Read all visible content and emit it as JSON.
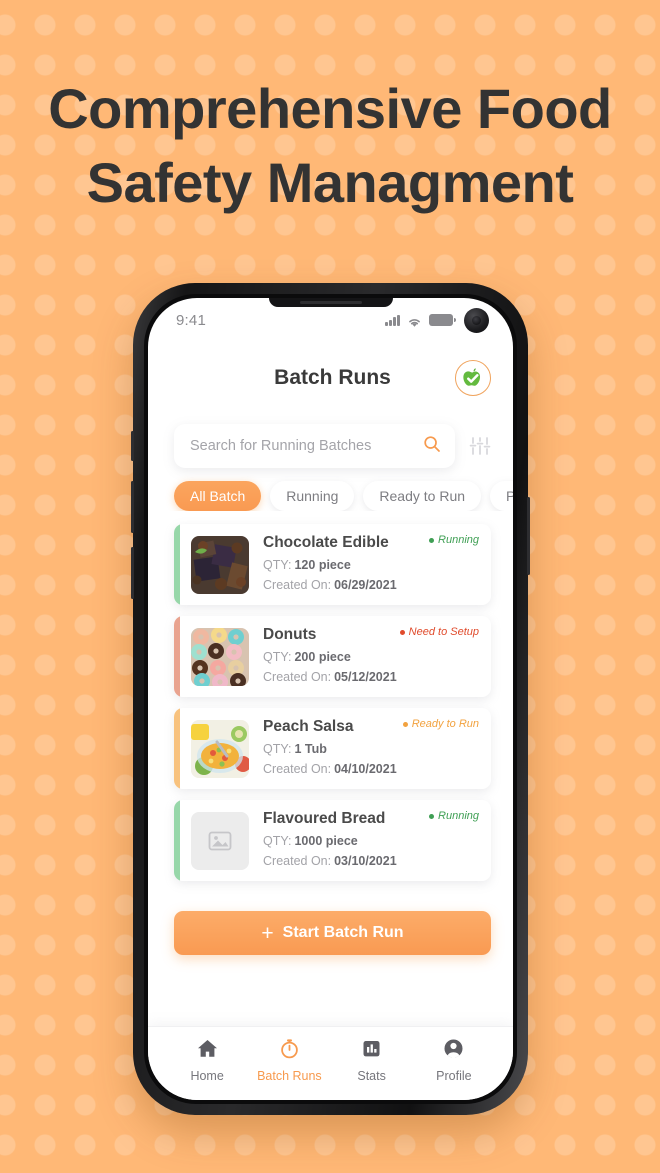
{
  "page": {
    "headline_line1": "Comprehensive Food",
    "headline_line2": "Safety Managment",
    "background_color": "#FFB876",
    "accent_color": "#F79A4E"
  },
  "status_bar": {
    "time": "9:41",
    "signal_icon": "cellular-signal-icon",
    "wifi_icon": "wifi-icon",
    "battery_icon": "battery-icon",
    "camera_icon": "front-camera-icon"
  },
  "app_header": {
    "title": "Batch Runs",
    "brand_badge_icon": "green-apple-check-badge-icon"
  },
  "search": {
    "placeholder": "Search for Running Batches",
    "value": "",
    "search_icon": "search-icon",
    "filter_icon": "filter-sliders-icon"
  },
  "chips": [
    {
      "label": "All Batch",
      "active": true
    },
    {
      "label": "Running",
      "active": false
    },
    {
      "label": "Ready to Run",
      "active": false
    },
    {
      "label": "Paused",
      "active": false
    }
  ],
  "batches": [
    {
      "title": "Chocolate Edible",
      "qty_label": "QTY:",
      "qty_value": "120 piece",
      "created_label": "Created On:",
      "created_value": "06/29/2021",
      "status": "Running",
      "status_color": "#3F9F54",
      "accent_color": "#97D7A9",
      "thumb": "chocolate-photo"
    },
    {
      "title": "Donuts",
      "qty_label": "QTY:",
      "qty_value": "200 piece",
      "created_label": "Created On:",
      "created_value": "05/12/2021",
      "status": "Need to Setup",
      "status_color": "#E04B2C",
      "accent_color": "#E9A38F",
      "thumb": "donuts-photo"
    },
    {
      "title": "Peach Salsa",
      "qty_label": "QTY:",
      "qty_value": "1 Tub",
      "created_label": "Created On:",
      "created_value": "04/10/2021",
      "status": "Ready to Run",
      "status_color": "#F2A23F",
      "accent_color": "#F8C27E",
      "thumb": "peach-salsa-photo"
    },
    {
      "title": "Flavoured Bread",
      "qty_label": "QTY:",
      "qty_value": "1000 piece",
      "created_label": "Created On:",
      "created_value": "03/10/2021",
      "status": "Running",
      "status_color": "#3F9F54",
      "accent_color": "#97D7A9",
      "thumb": "image-placeholder-icon"
    }
  ],
  "cta": {
    "plus": "+",
    "label": "Start Batch Run"
  },
  "tabbar": [
    {
      "label": "Home",
      "icon": "home-icon",
      "active": false
    },
    {
      "label": "Batch Runs",
      "icon": "stopwatch-icon",
      "active": true
    },
    {
      "label": "Stats",
      "icon": "bar-chart-icon",
      "active": false
    },
    {
      "label": "Profile",
      "icon": "person-icon",
      "active": false
    }
  ]
}
